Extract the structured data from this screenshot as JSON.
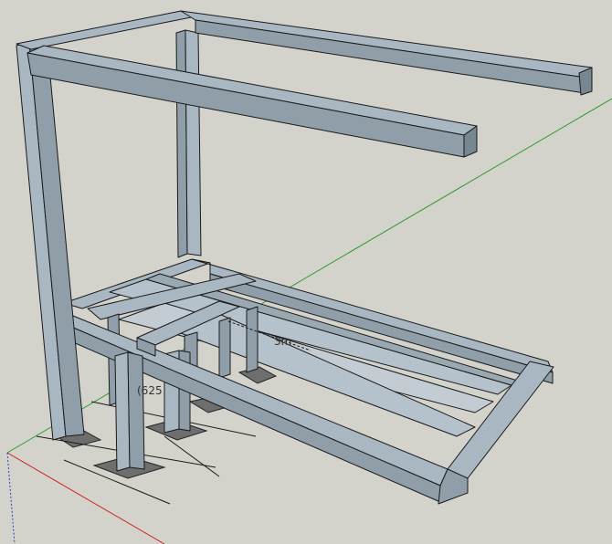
{
  "canvas": {
    "background_color": "#d3d3cc"
  },
  "colors": {
    "beam_top": "#a9b7c2",
    "beam_side": "#8f9ea9",
    "beam_dark": "#778792",
    "plate": "#6e6e6e",
    "axis_green": "#2e9a2e",
    "axis_red": "#cc2222",
    "axis_blue": "#3344bb"
  },
  "dimensions": {
    "label_left": "(625",
    "label_center": "3m"
  }
}
